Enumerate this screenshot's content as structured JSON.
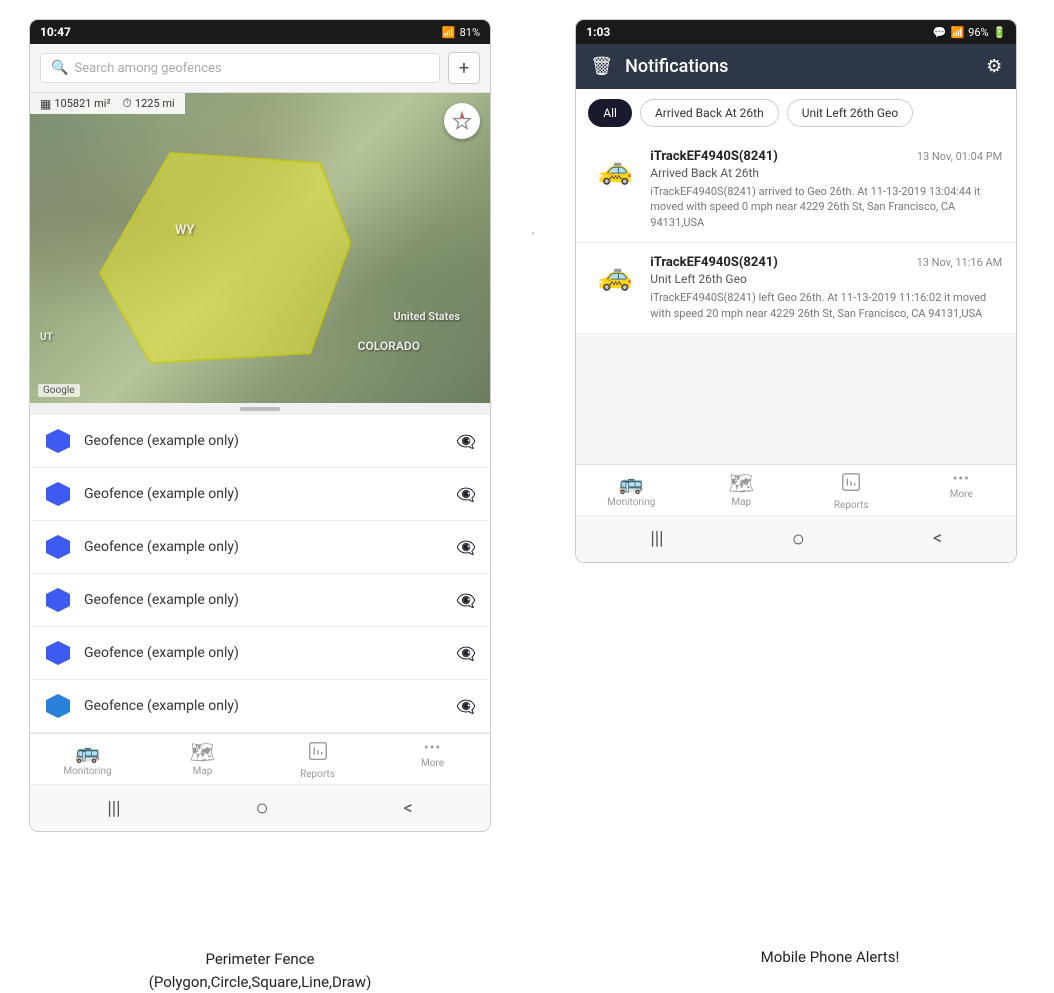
{
  "left_phone": {
    "status_bar": {
      "time": "10:47",
      "wifi": "WiFi",
      "signal": "81%"
    },
    "search": {
      "placeholder": "Search among geofences"
    },
    "stats": {
      "area": "105821 mi²",
      "distance": "1225 mi"
    },
    "map_labels": {
      "wy": "WY",
      "colorado": "COLORADO",
      "united_states": "United States",
      "ut": "UT"
    },
    "geofences": [
      {
        "name": "Geofence (example only)"
      },
      {
        "name": "Geofence (example only)"
      },
      {
        "name": "Geofence (example only)"
      },
      {
        "name": "Geofence (example only)"
      },
      {
        "name": "Geofence (example only)"
      },
      {
        "name": "Geofence (example only)"
      }
    ],
    "bottom_nav": [
      {
        "label": "Monitoring",
        "icon": "🚌"
      },
      {
        "label": "Map",
        "icon": "🗺"
      },
      {
        "label": "Reports",
        "icon": "📊"
      },
      {
        "label": "More",
        "icon": "···"
      }
    ],
    "android_nav": {
      "menu": "|||",
      "home": "○",
      "back": "<"
    }
  },
  "right_phone": {
    "status_bar": {
      "time": "1:03",
      "signal": "96%"
    },
    "header": {
      "title": "Notifications"
    },
    "filter_tabs": [
      {
        "label": "All",
        "active": true
      },
      {
        "label": "Arrived Back At 26th",
        "active": false
      },
      {
        "label": "Unit Left 26th Geo",
        "active": false
      }
    ],
    "notifications": [
      {
        "device": "iTrackEF4940S(8241)",
        "time": "13 Nov, 01:04 PM",
        "event": "Arrived Back At 26th",
        "detail": "iTrackEF4940S(8241) arrived to Geo 26th.    At 11-13-2019 13:04:44 it moved with speed 0 mph near 4229 26th St, San Francisco, CA 94131,USA"
      },
      {
        "device": "iTrackEF4940S(8241)",
        "time": "13 Nov, 11:16 AM",
        "event": "Unit Left 26th Geo",
        "detail": "iTrackEF4940S(8241) left Geo 26th.   At 11-13-2019 11:16:02 it moved with speed 20 mph near 4229 26th St, San Francisco, CA 94131,USA"
      }
    ],
    "bottom_nav": [
      {
        "label": "Monitoring",
        "icon": "🚌"
      },
      {
        "label": "Map",
        "icon": "🗺"
      },
      {
        "label": "Reports",
        "icon": "📊"
      },
      {
        "label": "More",
        "icon": "···"
      }
    ],
    "android_nav": {
      "menu": "|||",
      "home": "○",
      "back": "<"
    }
  },
  "captions": {
    "left": "Perimeter Fence\n(Polygon,Circle,Square,Line,Draw)",
    "right": "Mobile Phone Alerts!"
  }
}
